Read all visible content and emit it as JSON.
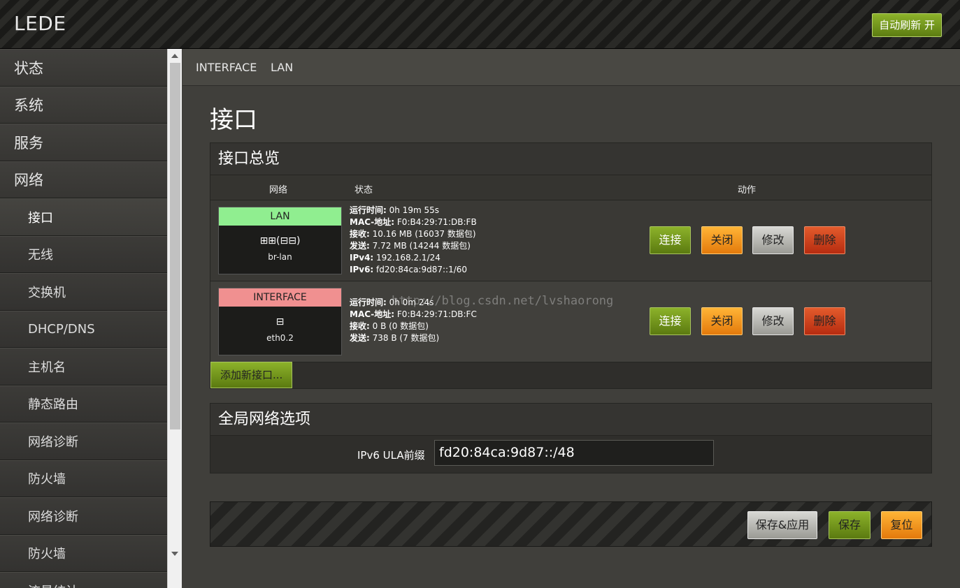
{
  "header": {
    "brand": "LEDE",
    "auto_refresh": "自动刷新 开"
  },
  "sidebar": {
    "items": [
      {
        "label": "状态",
        "level": "top"
      },
      {
        "label": "系统",
        "level": "top"
      },
      {
        "label": "服务",
        "level": "top"
      },
      {
        "label": "网络",
        "level": "top"
      },
      {
        "label": "接口",
        "level": "sub",
        "active": true
      },
      {
        "label": "无线",
        "level": "sub"
      },
      {
        "label": "交换机",
        "level": "sub"
      },
      {
        "label": "DHCP/DNS",
        "level": "sub"
      },
      {
        "label": "主机名",
        "level": "sub"
      },
      {
        "label": "静态路由",
        "level": "sub"
      },
      {
        "label": "网络诊断",
        "level": "sub"
      },
      {
        "label": "防火墙",
        "level": "sub"
      },
      {
        "label": "网络诊断",
        "level": "sub"
      },
      {
        "label": "防火墙",
        "level": "sub"
      },
      {
        "label": "流量统计",
        "level": "sub"
      }
    ]
  },
  "breadcrumb": [
    "INTERFACE",
    "LAN"
  ],
  "page_title": "接口",
  "overview": {
    "title": "接口总览",
    "columns": [
      "网络",
      "状态",
      "动作"
    ],
    "rows": [
      {
        "name": "LAN",
        "device": "br-lan",
        "icons": "⊞⊞(⊟⊟)",
        "status": [
          {
            "k": "运行时间:",
            "v": " 0h 19m 55s"
          },
          {
            "k": "MAC-地址:",
            "v": " F0:B4:29:71:DB:FB"
          },
          {
            "k": "接收:",
            "v": " 10.16 MB (16037 数据包)"
          },
          {
            "k": "发送:",
            "v": " 7.72 MB (14244 数据包)"
          },
          {
            "k": "IPv4:",
            "v": " 192.168.2.1/24"
          },
          {
            "k": "IPv6:",
            "v": " fd20:84ca:9d87::1/60"
          }
        ]
      },
      {
        "name": "INTERFACE",
        "device": "eth0.2",
        "icons": "⊟",
        "status": [
          {
            "k": "运行时间:",
            "v": " 0h 0m 24s"
          },
          {
            "k": "MAC-地址:",
            "v": " F0:B4:29:71:DB:FC"
          },
          {
            "k": "接收:",
            "v": " 0 B (0 数据包)"
          },
          {
            "k": "发送:",
            "v": " 738 B (7 数据包)"
          }
        ]
      }
    ],
    "actions": {
      "connect": "连接",
      "stop": "关闭",
      "edit": "修改",
      "delete": "删除"
    },
    "add_button": "添加新接口..."
  },
  "global": {
    "title": "全局网络选项",
    "ula_label": "IPv6 ULA前缀",
    "ula_value": "fd20:84ca:9d87::/48"
  },
  "footer": {
    "save_apply": "保存&应用",
    "save": "保存",
    "reset": "复位"
  },
  "watermark": "http://blog.csdn.net/lvshaorong",
  "colors": {
    "accent_green": "#7ca21f",
    "lan_color": "#90ee90",
    "iface_color": "#f09090",
    "orange": "#f5961e",
    "red": "#cc4420"
  }
}
